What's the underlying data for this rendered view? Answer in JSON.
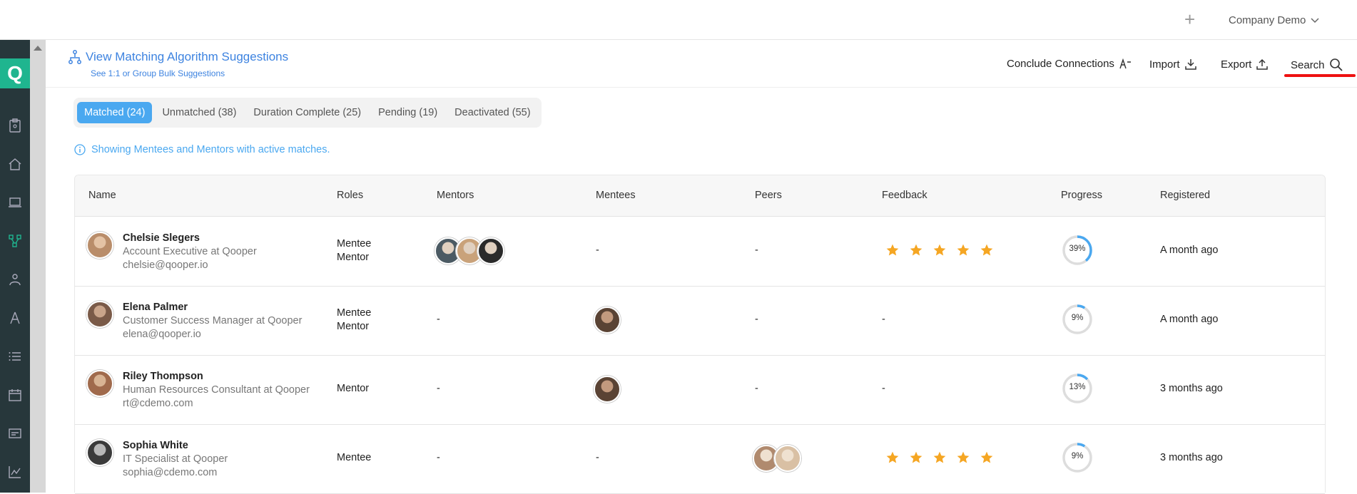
{
  "topbar": {
    "plus_icon": "plus-icon",
    "company": "Company Demo"
  },
  "sidebar": {
    "logo_letter": "Q",
    "icons": [
      "clipboard-icon",
      "home-icon",
      "laptop-icon",
      "network-icon",
      "people-icon",
      "compass-icon",
      "list-icon",
      "calendar-icon",
      "id-card-icon",
      "chart-icon"
    ]
  },
  "header": {
    "algo_title": "View Matching Algorithm Suggestions",
    "algo_subtitle": "See 1:1 or Group Bulk Suggestions",
    "actions": {
      "conclude": "Conclude Connections",
      "import": "Import",
      "export": "Export",
      "search": "Search"
    }
  },
  "tabs": [
    {
      "label": "Matched (24)",
      "active": true
    },
    {
      "label": "Unmatched (38)",
      "active": false
    },
    {
      "label": "Duration Complete (25)",
      "active": false
    },
    {
      "label": "Pending (19)",
      "active": false
    },
    {
      "label": "Deactivated (55)",
      "active": false
    }
  ],
  "info_text": "Showing Mentees and Mentors with active matches.",
  "table": {
    "columns": {
      "name": "Name",
      "roles": "Roles",
      "mentors": "Mentors",
      "mentees": "Mentees",
      "peers": "Peers",
      "feedback": "Feedback",
      "progress": "Progress",
      "registered": "Registered"
    },
    "rows": [
      {
        "name": "Chelsie Slegers",
        "title": "Account Executive at Qooper",
        "email": "chelsie@qooper.io",
        "roles": [
          "Mentee",
          "Mentor"
        ],
        "mentors_count": 3,
        "mentors_text": "",
        "mentees_count": 0,
        "mentees_text": "-",
        "peers_count": 0,
        "peers_text": "-",
        "feedback_stars": 5,
        "feedback_text": "",
        "progress": 39,
        "progress_label": "39%",
        "registered": "A month ago"
      },
      {
        "name": "Elena Palmer",
        "title": "Customer Success Manager at Qooper",
        "email": "elena@qooper.io",
        "roles": [
          "Mentee",
          "Mentor"
        ],
        "mentors_count": 0,
        "mentors_text": "-",
        "mentees_count": 1,
        "mentees_text": "",
        "peers_count": 0,
        "peers_text": "-",
        "feedback_stars": 0,
        "feedback_text": "-",
        "progress": 9,
        "progress_label": "9%",
        "registered": "A month ago"
      },
      {
        "name": "Riley Thompson",
        "title": "Human Resources Consultant at Qooper",
        "email": "rt@cdemo.com",
        "roles": [
          "Mentor"
        ],
        "mentors_count": 0,
        "mentors_text": "-",
        "mentees_count": 1,
        "mentees_text": "",
        "peers_count": 0,
        "peers_text": "-",
        "feedback_stars": 0,
        "feedback_text": "-",
        "progress": 13,
        "progress_label": "13%",
        "registered": "3 months ago"
      },
      {
        "name": "Sophia White",
        "title": "IT Specialist at Qooper",
        "email": "sophia@cdemo.com",
        "roles": [
          "Mentee"
        ],
        "mentors_count": 0,
        "mentors_text": "-",
        "mentees_count": 0,
        "mentees_text": "-",
        "peers_count": 2,
        "peers_text": "",
        "feedback_stars": 5,
        "feedback_text": "",
        "progress": 9,
        "progress_label": "9%",
        "registered": "3 months ago"
      }
    ]
  },
  "colors": {
    "accent": "#4aa8f0",
    "link": "#3d83e0",
    "sidebar": "#27373b",
    "logo": "#1fb58f",
    "star": "#f5a623",
    "progress_track": "#dddddd",
    "highlight": "#e11111"
  }
}
